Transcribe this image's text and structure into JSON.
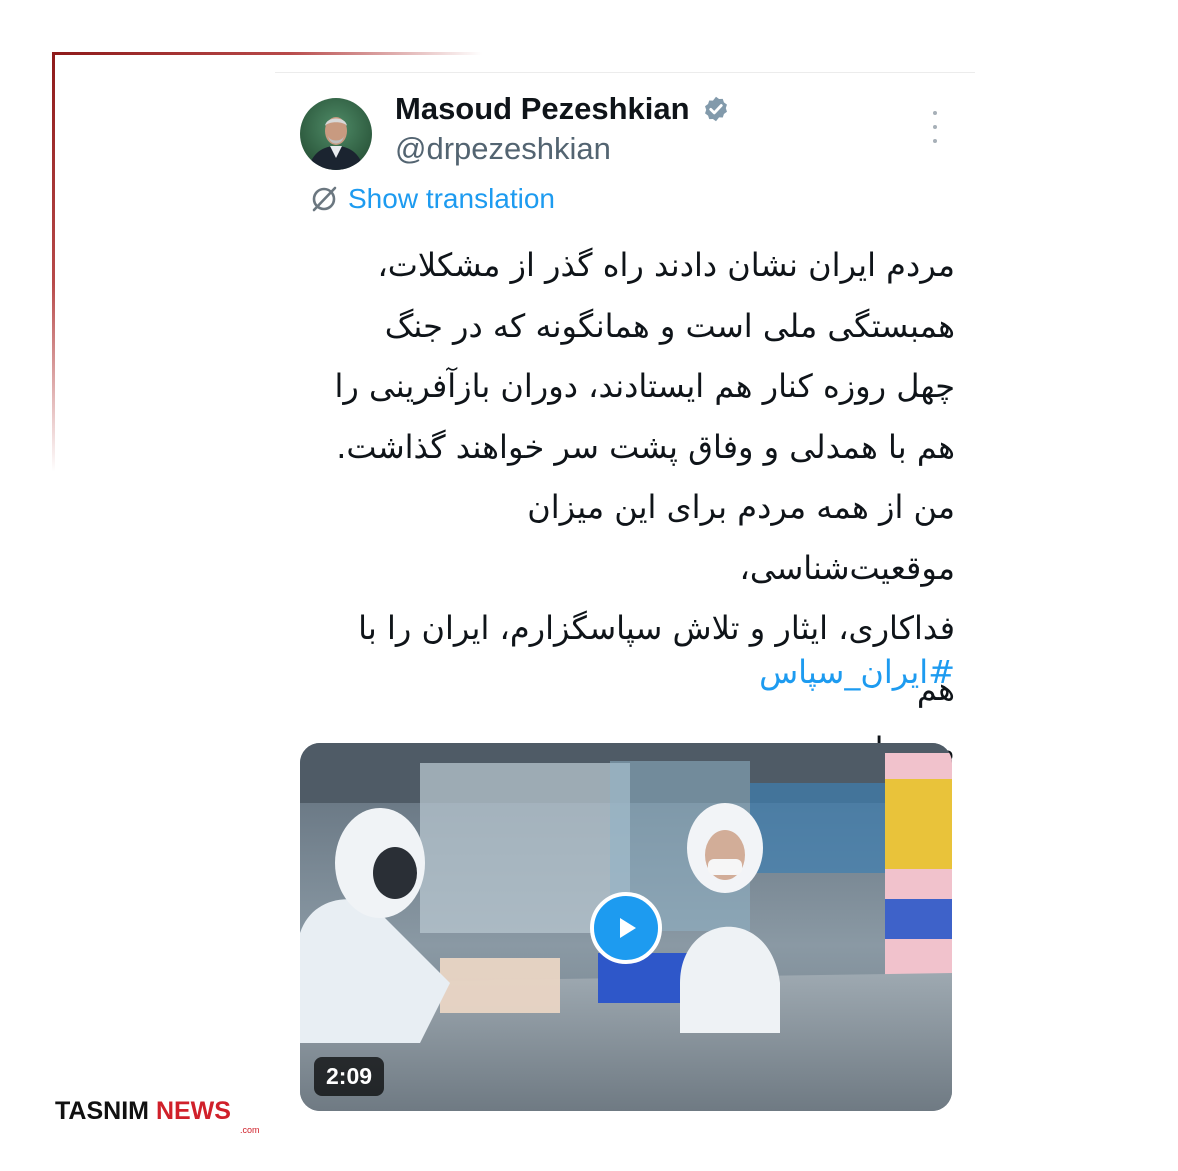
{
  "tweet": {
    "author_name": "Masoud Pezeshkian",
    "author_handle": "@drpezeshkian",
    "translate_label": "Show translation",
    "body_lines": [
      "مردم ایران نشان دادند راه گذر از مشکلات،",
      "همبستگی ملی است و همانگونه که در جنگ",
      "چهل روزه کنار هم ایستادند، دوران بازآفرینی را",
      "هم با همدلی و وفاق پشت سر خواهند گذاشت.",
      "من از همه مردم برای این میزان موقعیت‌شناسی،",
      "فداکاری، ایثار و تلاش سپاسگزارم، ایران را با هم",
      "می‌سازیم."
    ],
    "hashtag": "#ایران_سپاس",
    "video_duration": "2:09"
  },
  "watermark": {
    "brand_part1": "TASNIM",
    "brand_part2": "NEWS",
    "domain": ".com"
  },
  "icons": {
    "verified": "verified-badge-icon",
    "more": "more-options-icon",
    "translate": "translate-icon",
    "play": "play-icon"
  },
  "colors": {
    "accent_blue": "#1d9bf0",
    "handle_gray": "#536471",
    "text_dark": "#0f1419",
    "verified_gray": "#829aab",
    "watermark_red": "#d0202a",
    "frame_red": "#8e1a1a"
  }
}
